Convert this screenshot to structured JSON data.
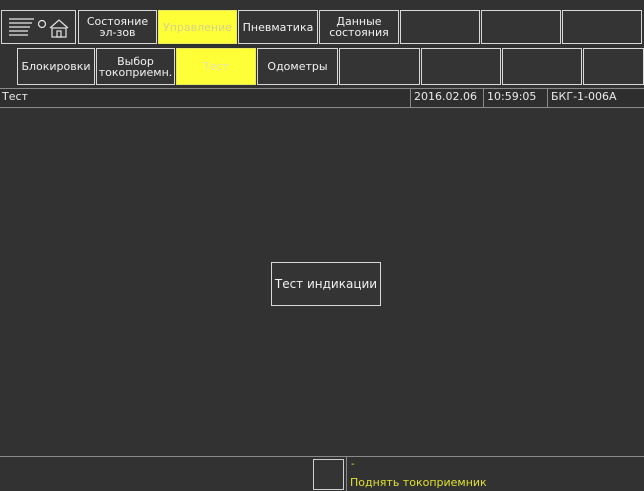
{
  "top_tabs": {
    "state": [
      "Состояние",
      "эл-зов"
    ],
    "control": "Управление",
    "pneumatics": "Пневматика",
    "data": [
      "Данные",
      "состояния"
    ]
  },
  "sub_tabs": {
    "locks": "Блокировки",
    "pantograph": [
      "Выбор",
      "токоприемн."
    ],
    "test": "Тест",
    "odometers": "Одометры"
  },
  "status": {
    "title": "Тест",
    "date": "2016.02.06",
    "time": "10:59:05",
    "unit": "БКГ-1-006А"
  },
  "main": {
    "indication_test_label": "Тест индикации"
  },
  "footer": {
    "dash": "-",
    "message": "Поднять токоприемник"
  },
  "colors": {
    "background": "#323232",
    "active_tab": "#ffff38",
    "message_text": "#e0e030"
  }
}
